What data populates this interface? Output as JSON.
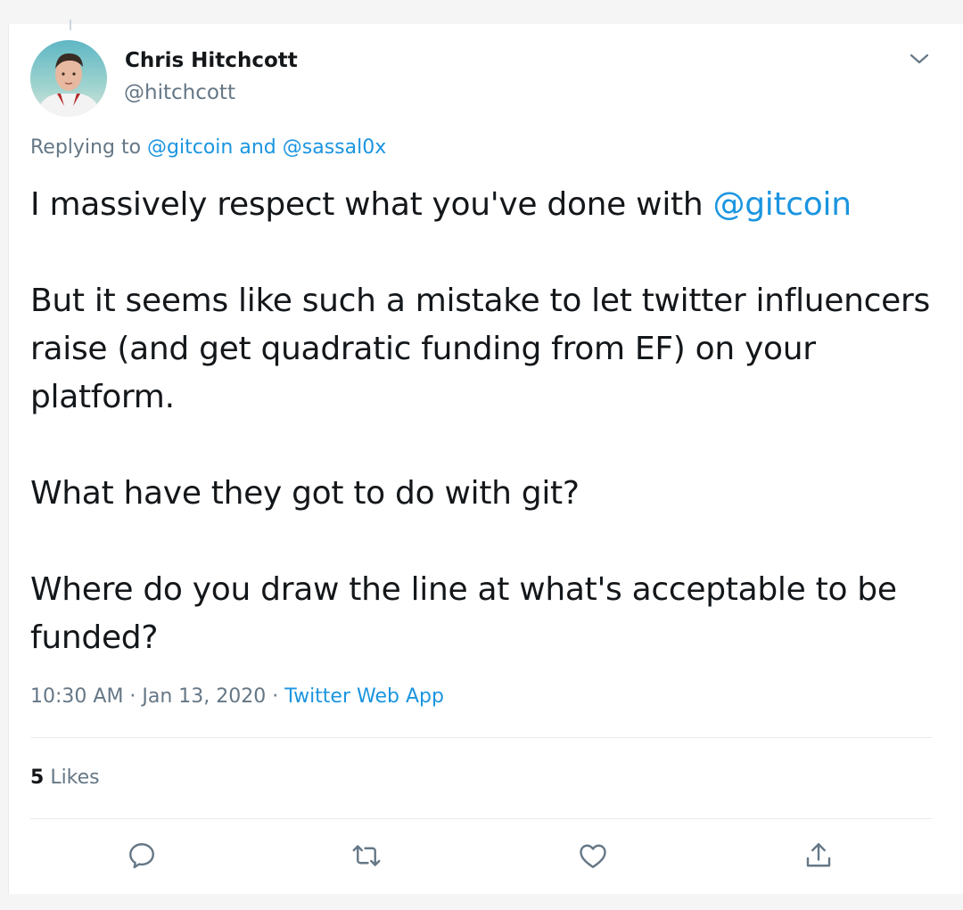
{
  "tweet": {
    "author_name": "Chris Hitchcott",
    "author_handle": "@hitchcott",
    "replying_prefix": "Replying to",
    "replying_to_1": "@gitcoin",
    "replying_and": "and",
    "replying_to_2": "@sassal0x",
    "line1_text": "I massively respect what you've done with ",
    "line1_mention": "@gitcoin",
    "para2": "But it seems like such a mistake to let twitter influencers raise (and get quadratic funding from EF) on your platform.",
    "para3": "What have they got to do with git?",
    "para4": "Where do you draw the line at what's acceptable to be funded?",
    "timestamp": "10:30 AM · Jan 13, 2020",
    "separator": "·",
    "source": "Twitter Web App",
    "likes_count": "5",
    "likes_label": "Likes"
  },
  "icons": {
    "more": "chevron-down-icon",
    "reply": "reply-icon",
    "retweet": "retweet-icon",
    "like": "heart-icon",
    "share": "share-icon"
  },
  "colors": {
    "link": "#1b95e0",
    "text": "#14171a",
    "secondary": "#657786",
    "divider": "#e6ecf0"
  }
}
